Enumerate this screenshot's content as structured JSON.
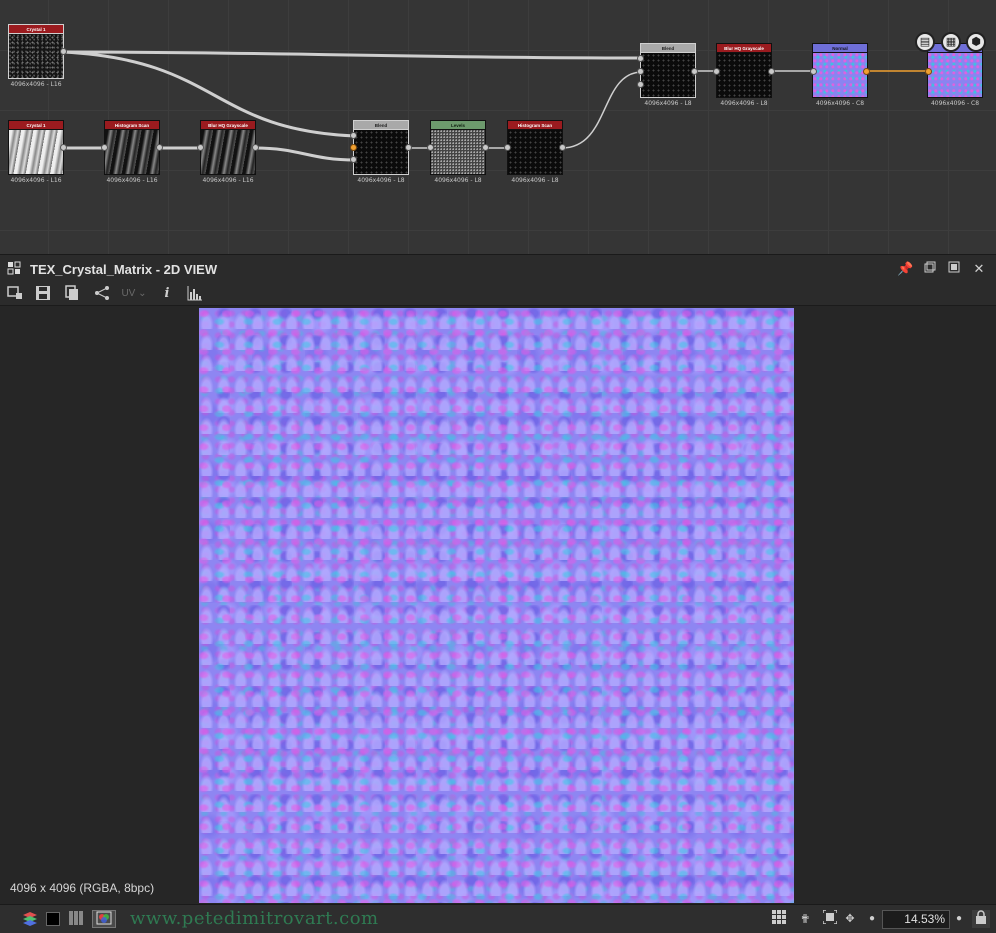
{
  "graph": {
    "nodes": [
      {
        "id": "crystal1_a",
        "title": "Crystal 1",
        "res": "4096x4096 - L16"
      },
      {
        "id": "crystal1_b",
        "title": "Crystal 1",
        "res": "4096x4096 - L16"
      },
      {
        "id": "hist_scan_a",
        "title": "Histogram Scan",
        "res": "4096x4096 - L16"
      },
      {
        "id": "blur_a",
        "title": "Blur HQ Grayscale",
        "res": "4096x4096 - L16"
      },
      {
        "id": "blend_a",
        "title": "Blend",
        "res": "4096x4096 - L8"
      },
      {
        "id": "levels",
        "title": "Levels",
        "res": "4096x4096 - L8"
      },
      {
        "id": "hist_scan_b",
        "title": "Histogram Scan",
        "res": "4096x4096 - L8"
      },
      {
        "id": "blend_b",
        "title": "Blend",
        "res": "4096x4096 - L8"
      },
      {
        "id": "blur_b",
        "title": "Blur HQ Grayscale",
        "res": "4096x4096 - L8"
      },
      {
        "id": "normal",
        "title": "Normal",
        "res": "4096x4096 - C8"
      },
      {
        "id": "output",
        "title": "",
        "res": "4096x4096 - C8"
      }
    ],
    "output_icons": [
      "document-icon",
      "checker-icon",
      "cube-icon"
    ]
  },
  "view": {
    "title": "TEX_Crystal_Matrix - 2D VIEW",
    "uv_label": "UV",
    "resolution_info": "4096 x 4096 (RGBA, 8bpc)"
  },
  "statusbar": {
    "watermark": "www.petedimitrovart.com",
    "zoom": "14.53%"
  },
  "colors": {
    "node_red": "#9b1b1f",
    "node_gray": "#a9a9a9",
    "node_green": "#6d9a6d",
    "node_blue": "#6f6fd8",
    "link_orange": "#f0a030",
    "normal_map_base": "#8e86f2"
  }
}
